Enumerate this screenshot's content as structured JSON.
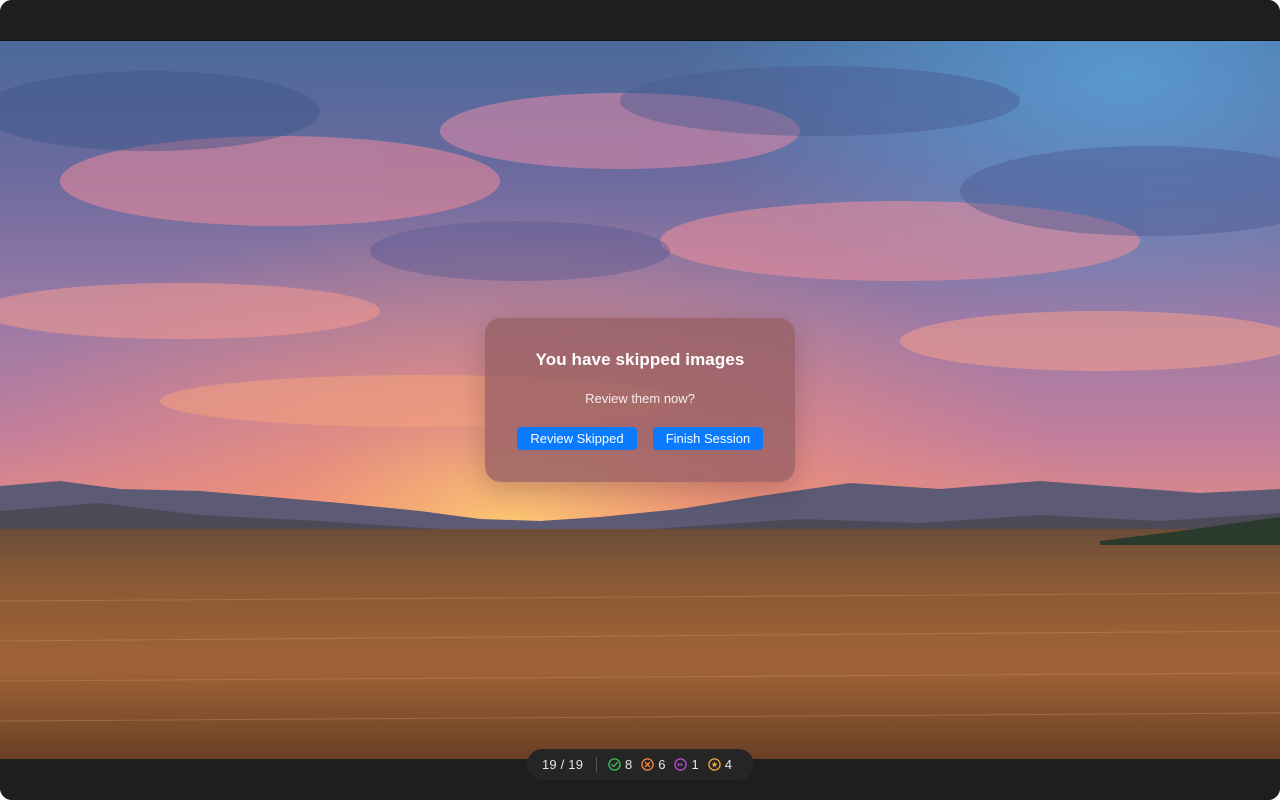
{
  "dialog": {
    "title": "You have skipped images",
    "message": "Review them now?",
    "review_label": "Review Skipped",
    "finish_label": "Finish Session"
  },
  "status": {
    "counter": "19 / 19",
    "accepted": {
      "icon": "check-circle-icon",
      "count": "8",
      "color": "#34c759"
    },
    "rejected": {
      "icon": "x-circle-icon",
      "count": "6",
      "color": "#ff8a3d"
    },
    "skipped": {
      "icon": "skip-circle-icon",
      "count": "1",
      "color": "#c34ddc"
    },
    "starred": {
      "icon": "star-circle-icon",
      "count": "4",
      "color": "#f0a93b"
    }
  },
  "colors": {
    "accent": "#0a7aff",
    "chrome": "#1e1e1e"
  }
}
